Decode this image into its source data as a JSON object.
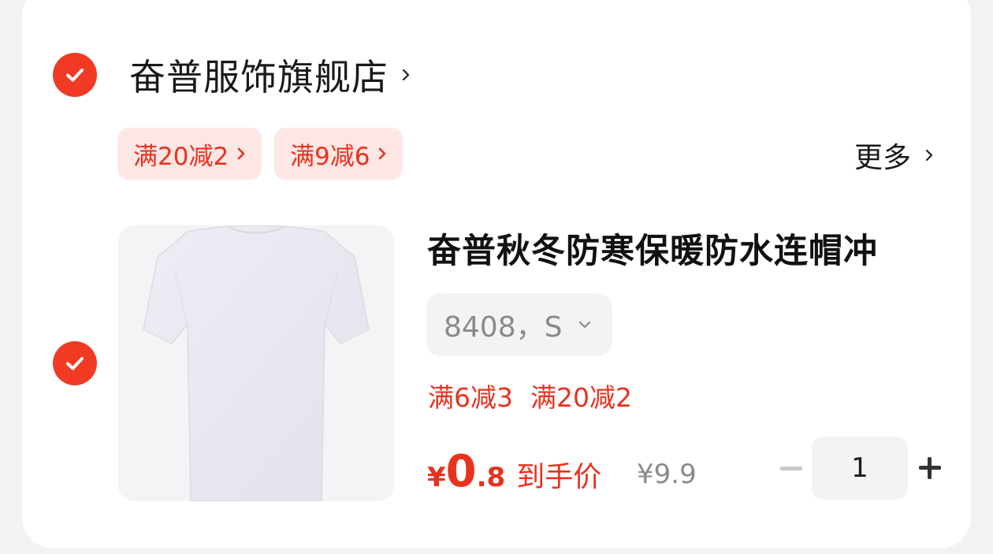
{
  "colors": {
    "accent": "#f03a24",
    "promo_text": "#e8321f",
    "promo_bg": "#fde7e4"
  },
  "store": {
    "name": "奋普服饰旗舰店",
    "checked": true
  },
  "promos": [
    {
      "label": "满20减2"
    },
    {
      "label": "满9减6"
    }
  ],
  "more_label": "更多",
  "item": {
    "checked": true,
    "image_icon": "white-tshirt",
    "title": "奋普秋冬防寒保暖防水连帽冲",
    "sku": "8408，S",
    "discounts": [
      "满6减3",
      "满20减2"
    ],
    "price": {
      "currency": "¥",
      "integer": "0",
      "decimal": ".8",
      "label": "到手价"
    },
    "original_price": "¥9.9",
    "quantity": "1"
  }
}
